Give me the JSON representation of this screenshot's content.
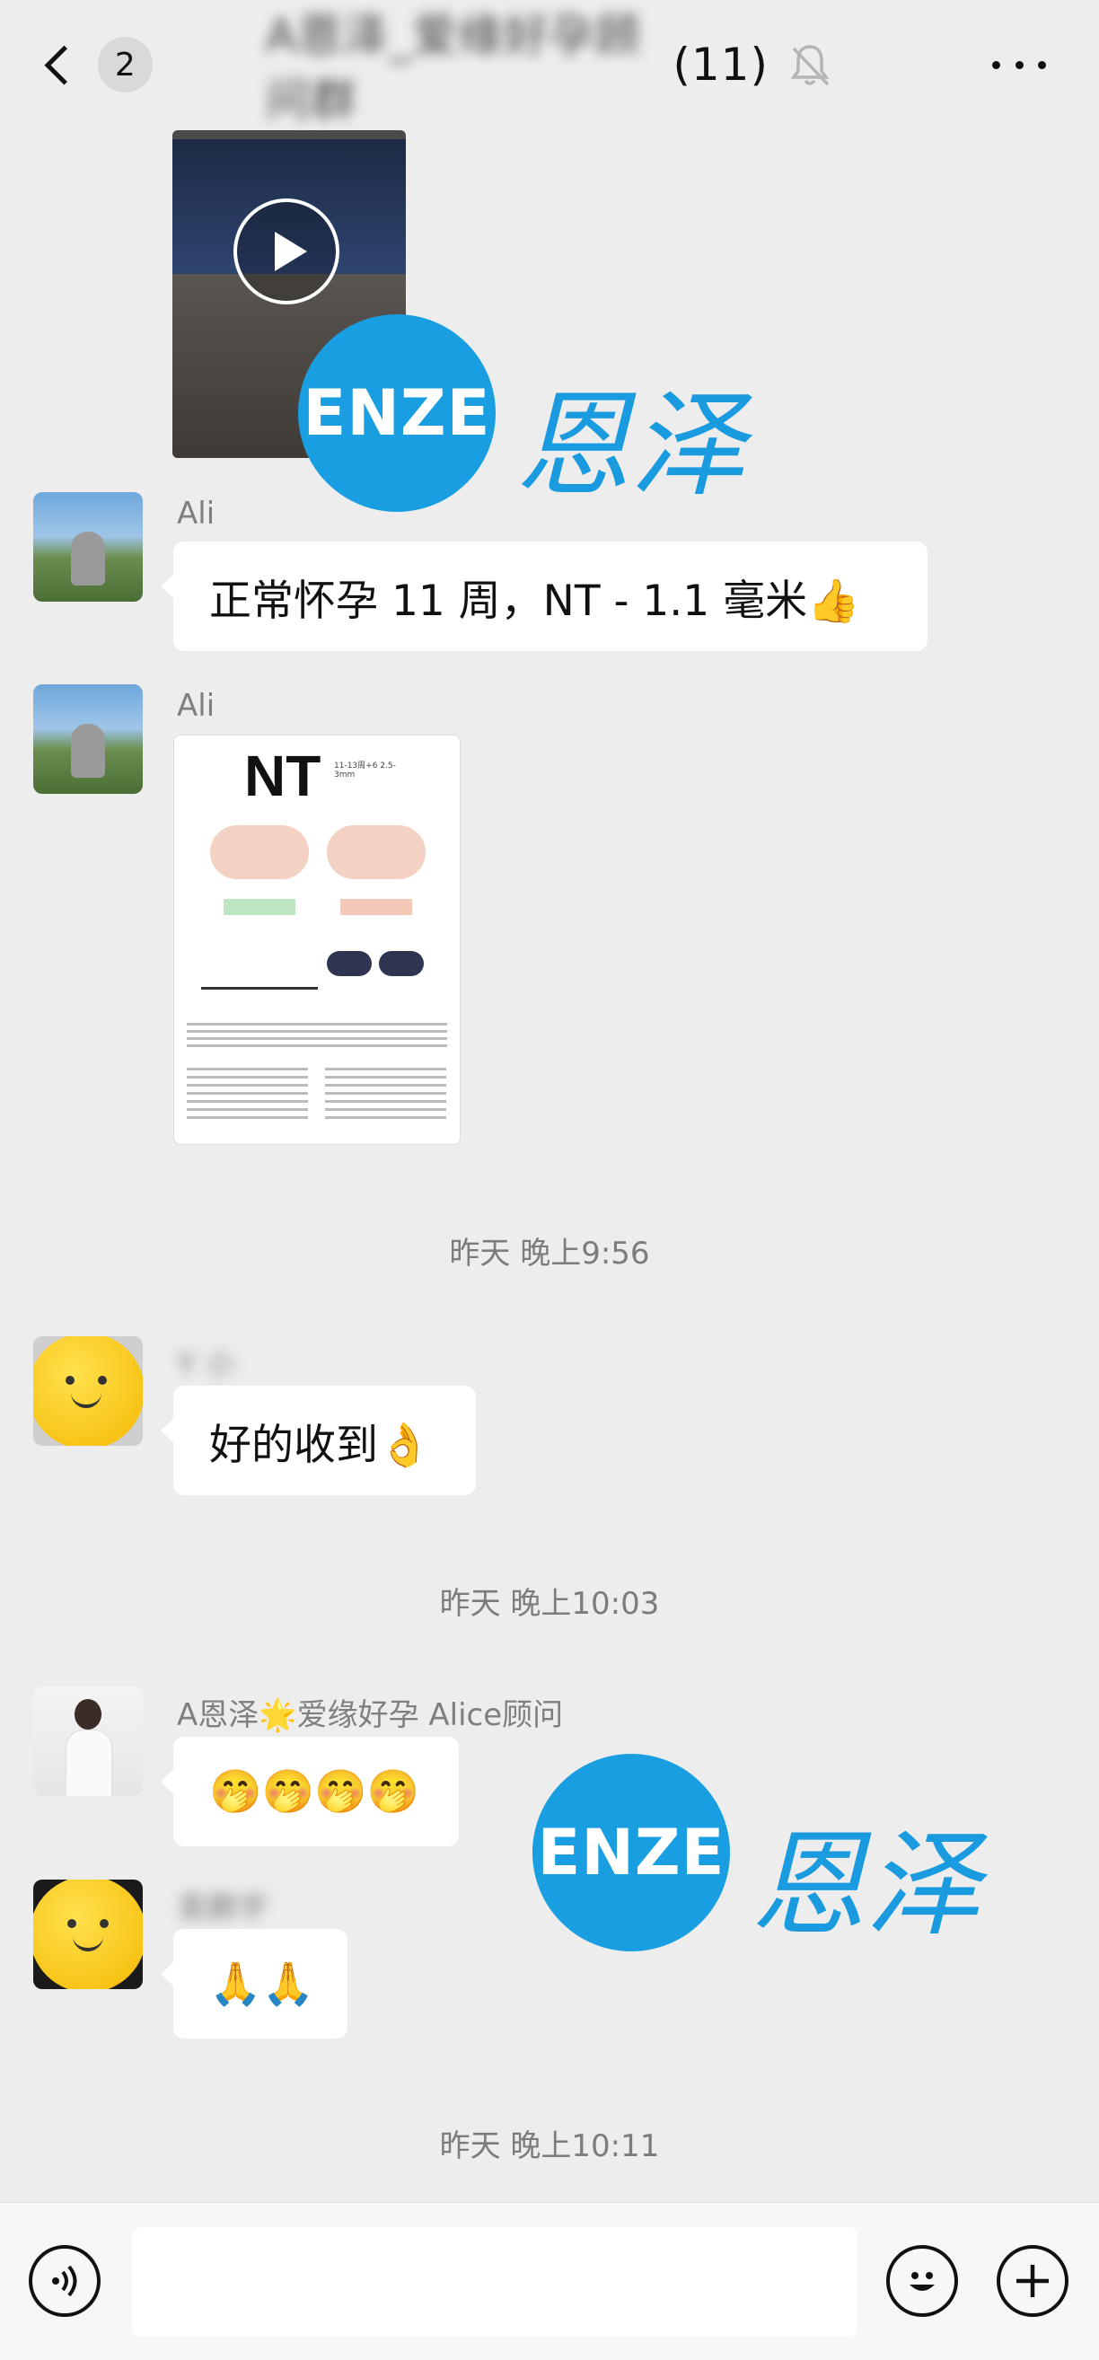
{
  "header": {
    "unread_count": "2",
    "chat_title_blurred": "A恩泽_爱缘好孕顾问群",
    "member_count": "(11)"
  },
  "messages": [
    {
      "type": "video"
    },
    {
      "sender": "Ali",
      "text": "正常怀孕 11 周，NT - 1.1 毫米👍"
    },
    {
      "sender": "Ali",
      "type": "image",
      "image_title": "NT",
      "image_sub": "11-13周+6 2.5-3mm"
    },
    {
      "time": "昨天 晚上9:56"
    },
    {
      "sender_blurred": "Y 小",
      "text": "好的收到👌"
    },
    {
      "time": "昨天 晚上10:03"
    },
    {
      "sender": "A恩泽🌟爱缘好孕 Alice顾问",
      "text": "🤭🤭🤭🤭"
    },
    {
      "sender_blurred": "袁鹏宇",
      "text": "🙏🙏"
    },
    {
      "time": "昨天 晚上10:11"
    }
  ],
  "watermark": {
    "logo_text": "ENZE",
    "cn_text": "恩泽"
  },
  "colors": {
    "background": "#ededed",
    "bubble": "#ffffff",
    "brand_blue": "#199fe1"
  },
  "icons": [
    "back-chevron-icon",
    "mute-bell-icon",
    "more-icon",
    "voice-icon",
    "emoji-icon",
    "plus-icon",
    "play-icon"
  ]
}
